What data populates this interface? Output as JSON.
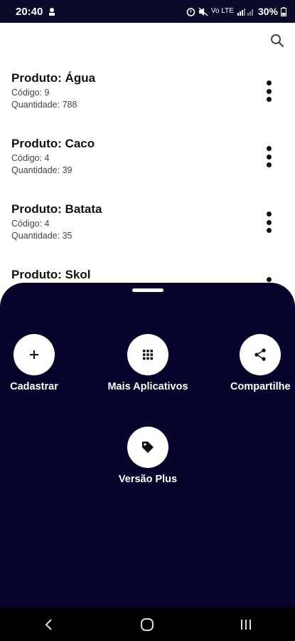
{
  "status": {
    "time": "20:40",
    "battery": "30%",
    "net_label": "Vo LTE"
  },
  "search": {
    "icon": "search-icon"
  },
  "products": [
    {
      "title": "Produto: Água",
      "code": "Código: 9",
      "quantity": "Quantidade: 788"
    },
    {
      "title": "Produto: Caco",
      "code": "Código: 4",
      "quantity": "Quantidade: 39"
    },
    {
      "title": "Produto: Batata",
      "code": "Código: 4",
      "quantity": "Quantidade: 35"
    },
    {
      "title": "Produto: Skol",
      "code": "",
      "quantity": ""
    }
  ],
  "sheet": {
    "actions": [
      {
        "label": "Cadastrar",
        "icon": "plus-icon"
      },
      {
        "label": "Mais Aplicativos",
        "icon": "apps-grid-icon"
      },
      {
        "label": "Compartilhe",
        "icon": "share-icon"
      },
      {
        "label": "Versão Plus",
        "icon": "tag-icon"
      }
    ]
  },
  "colors": {
    "sheet_bg": "#05052b",
    "status_bg": "#0a0a2a",
    "nav_bg": "#000000"
  }
}
